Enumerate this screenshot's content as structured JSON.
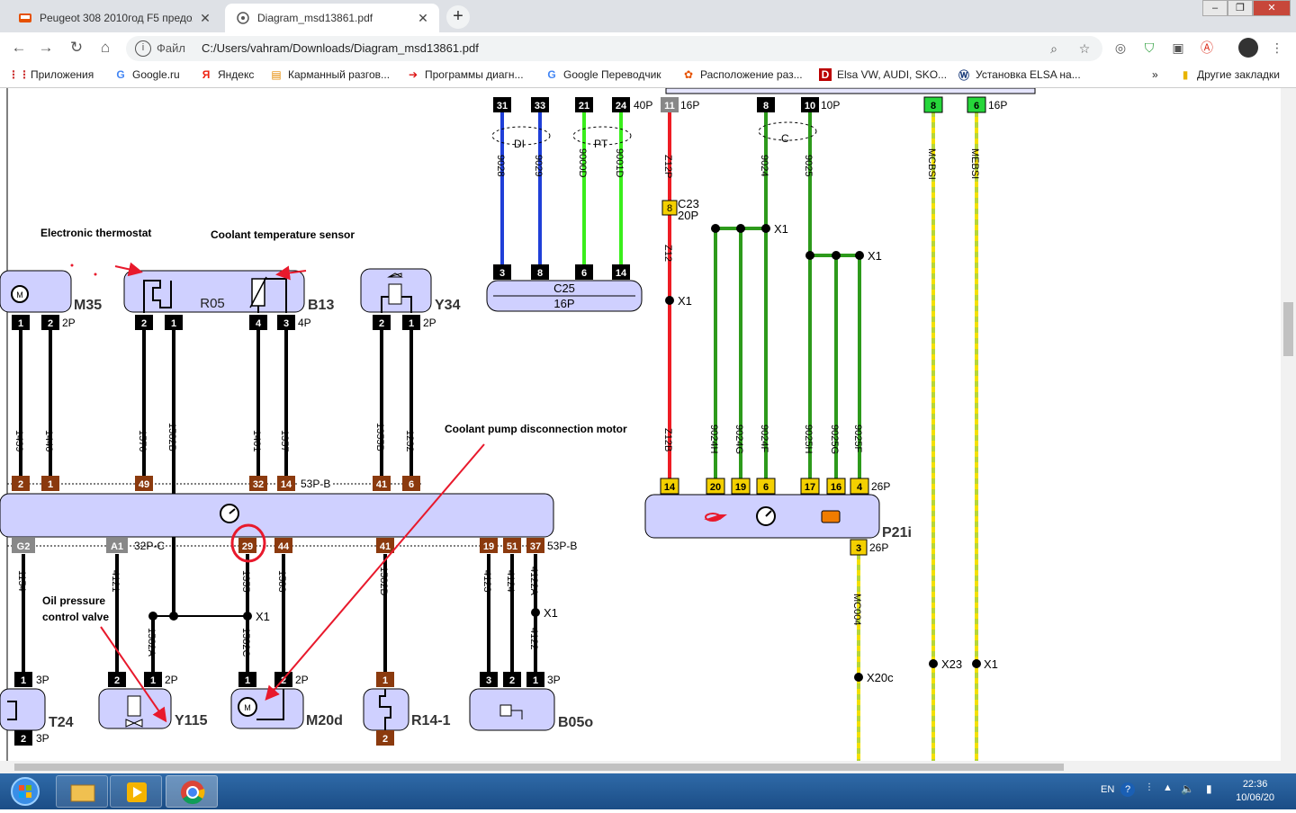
{
  "tabs": [
    {
      "title": "Peugeot 308 2010год F5 предохранители",
      "active": false
    },
    {
      "title": "Diagram_msd13861.pdf",
      "active": true
    }
  ],
  "omnibox": {
    "scheme": "Файл",
    "url": "C:/Users/vahram/Downloads/Diagram_msd13861.pdf"
  },
  "bookmarks": [
    {
      "label": "Приложения",
      "icon": "apps-grid-icon"
    },
    {
      "label": "Google.ru",
      "icon": "google-icon"
    },
    {
      "label": "Яндекс",
      "icon": "yandex-icon"
    },
    {
      "label": "Карманный разгов...",
      "icon": "bookmark-site-icon"
    },
    {
      "label": "Программы диагн...",
      "icon": "red-arrow-icon"
    },
    {
      "label": "Google Переводчик",
      "icon": "google-icon"
    },
    {
      "label": "Расположение раз...",
      "icon": "site-icon"
    },
    {
      "label": "Elsa VW, AUDI, SKO...",
      "icon": "d-icon"
    },
    {
      "label": "Установка ELSA на...",
      "icon": "vw-icon"
    },
    {
      "label": "»",
      "icon": ""
    },
    {
      "label": "Другие закладки",
      "icon": "folder-icon"
    }
  ],
  "taskbar": {
    "lang": "EN",
    "time": "22:36",
    "date": "10/06/20"
  },
  "diagram": {
    "annotations": {
      "thermostat": "Electronic thermostat",
      "coolant_sensor": "Coolant temperature sensor",
      "pump_motor": "Coolant pump disconnection motor",
      "oil_valve_1": "Oil pressure",
      "oil_valve_2": "control valve"
    },
    "components": {
      "m35": "M35",
      "r05": "R05",
      "b13": "B13",
      "y34": "Y34",
      "c25": "C25",
      "c25_pins": "16P",
      "p21i": "P21i",
      "t24": "T24",
      "y115": "Y115",
      "m20d": "M20d",
      "r14": "R14-1",
      "b05o": "B05o"
    },
    "top_connectors": {
      "left_pins": [
        "31",
        "33",
        "21",
        "24"
      ],
      "left_label": "40P",
      "pin11": "11",
      "pin11_label": "16P",
      "mid_pins": [
        "8",
        "10"
      ],
      "mid_label": "10P",
      "right_pins": [
        "8",
        "6"
      ],
      "right_label": "16P"
    },
    "twist_labels": [
      "DI",
      "PT",
      "C"
    ],
    "wire_labels_top": [
      "9028",
      "9029",
      "9000D",
      "9001D",
      "Z12P",
      "Z12",
      "9024",
      "9025",
      "MCBSI",
      "MEBSI"
    ],
    "c23": {
      "pin": "8",
      "name": "C23",
      "pins": "20P"
    },
    "c25_pins_list": [
      "3",
      "8",
      "6",
      "14"
    ],
    "splice": "X1",
    "splice_x20c": "X20c",
    "splice_x23": "X23",
    "m35_pins": [
      "1",
      "2"
    ],
    "m35_type": "2P",
    "r05_pins": [
      "2",
      "1"
    ],
    "b13_pins": [
      "4",
      "3"
    ],
    "b13_type": "4P",
    "y34_pins": [
      "2",
      "1"
    ],
    "y34_type": "2P",
    "mid_wires": [
      "1439",
      "1440",
      "1570",
      "1582B",
      "1401",
      "1357",
      "1355B",
      "1232"
    ],
    "ecu_top_pins": [
      "2",
      "1",
      "49",
      "32",
      "14"
    ],
    "ecu_top_label": "53P-B",
    "ecu_top_pins2": [
      "41",
      "6"
    ],
    "ecu_bottom_pins": [
      "G2",
      "A1",
      "29",
      "44",
      "41",
      "19",
      "51",
      "37"
    ],
    "ecu_bottom_label1": "32P-C",
    "ecu_bottom_label2": "53P-B",
    "bottom_wires": [
      "1154",
      "4121",
      "1355",
      "1583",
      "1582D",
      "4123",
      "4124",
      "4122A",
      "1582A",
      "1582C",
      "4122"
    ],
    "p21_pins": [
      "14",
      "20",
      "19",
      "6",
      "17",
      "16",
      "4"
    ],
    "p21_label": "26P",
    "p21_wires": [
      "Z12B",
      "9024H",
      "9024G",
      "9024F",
      "9025H",
      "9025G",
      "9025F"
    ],
    "p21_pin3": "3",
    "p21_pin3_label": "26P",
    "mc004": "MC004",
    "t24_pins": [
      "1",
      "2"
    ],
    "t24_type": "3P",
    "t24_type2": "3P",
    "y115_pins": [
      "2",
      "1"
    ],
    "y115_type": "2P",
    "m20d_pins": [
      "1",
      "2"
    ],
    "m20d_type": "2P",
    "r14_pins": [
      "1",
      "2"
    ],
    "b05o_pins": [
      "3",
      "2",
      "1"
    ],
    "b05o_type": "3P"
  }
}
